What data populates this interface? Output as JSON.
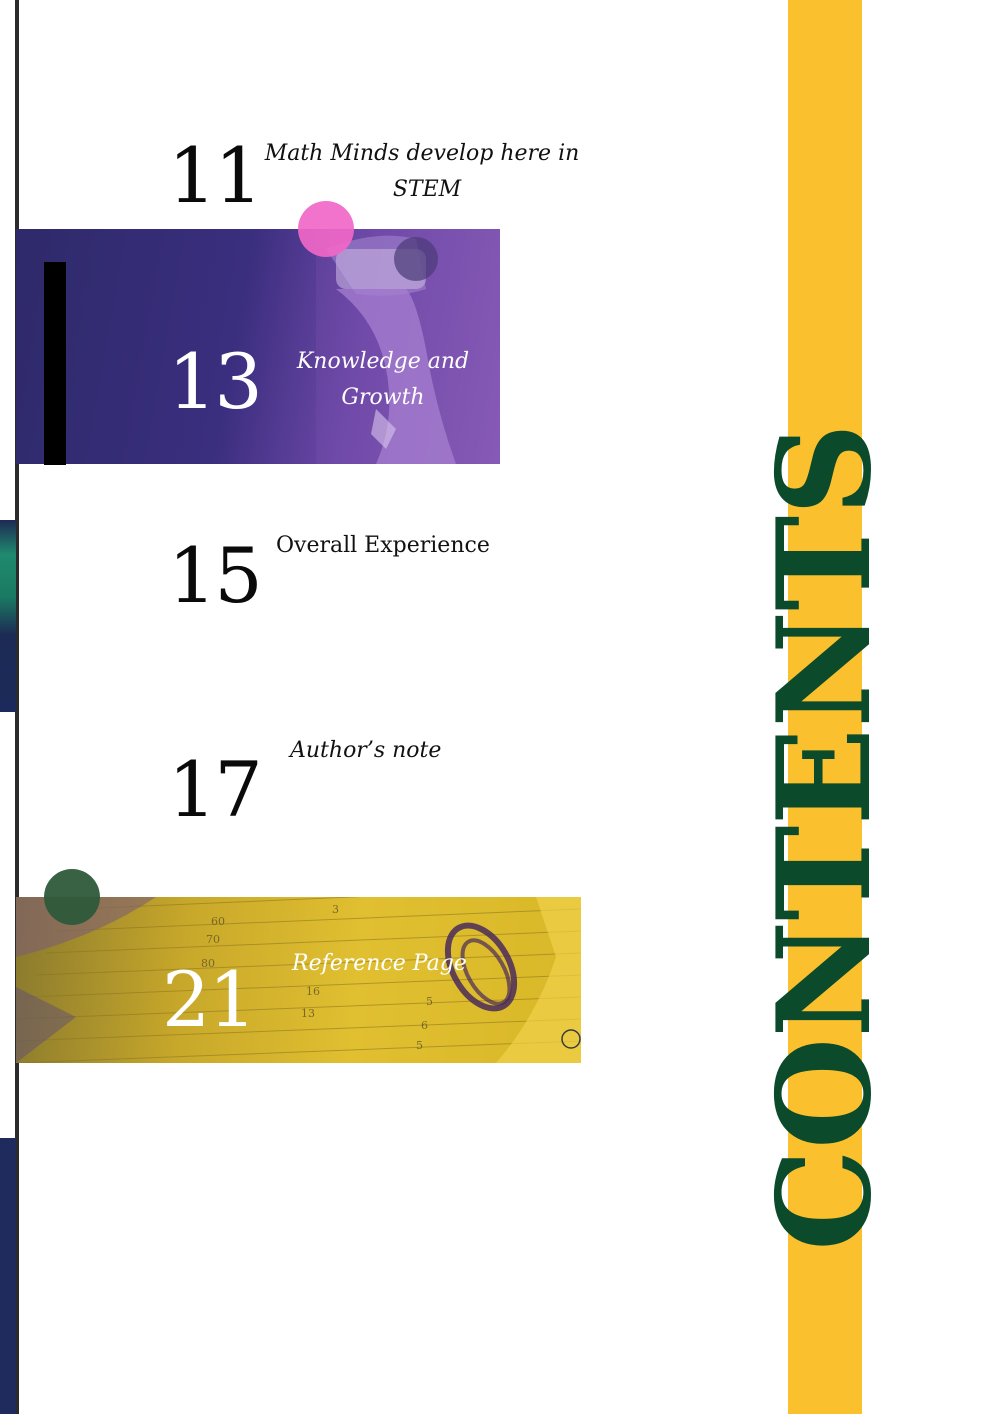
{
  "title": "CONTENTS",
  "entries": [
    {
      "page": "11",
      "label_line1": "Math Minds develop here in",
      "label_line2": "STEM"
    },
    {
      "page": "13",
      "label_line1": "Knowledge and",
      "label_line2": "Growth"
    },
    {
      "page": "15",
      "label": "Overall Experience"
    },
    {
      "page": "17",
      "label": "Author’s note"
    },
    {
      "page": "21",
      "label": "Reference Page"
    }
  ],
  "notebook_marks": [
    "60",
    "70",
    "80",
    "16",
    "13",
    "5",
    "6",
    "5",
    "3"
  ],
  "colors": {
    "accent_yellow": "#fbc02d",
    "title_green": "#0b4a2a",
    "purple": "#3a2e7e",
    "pink": "#f067c8",
    "dot_green": "#2e5a3a"
  }
}
